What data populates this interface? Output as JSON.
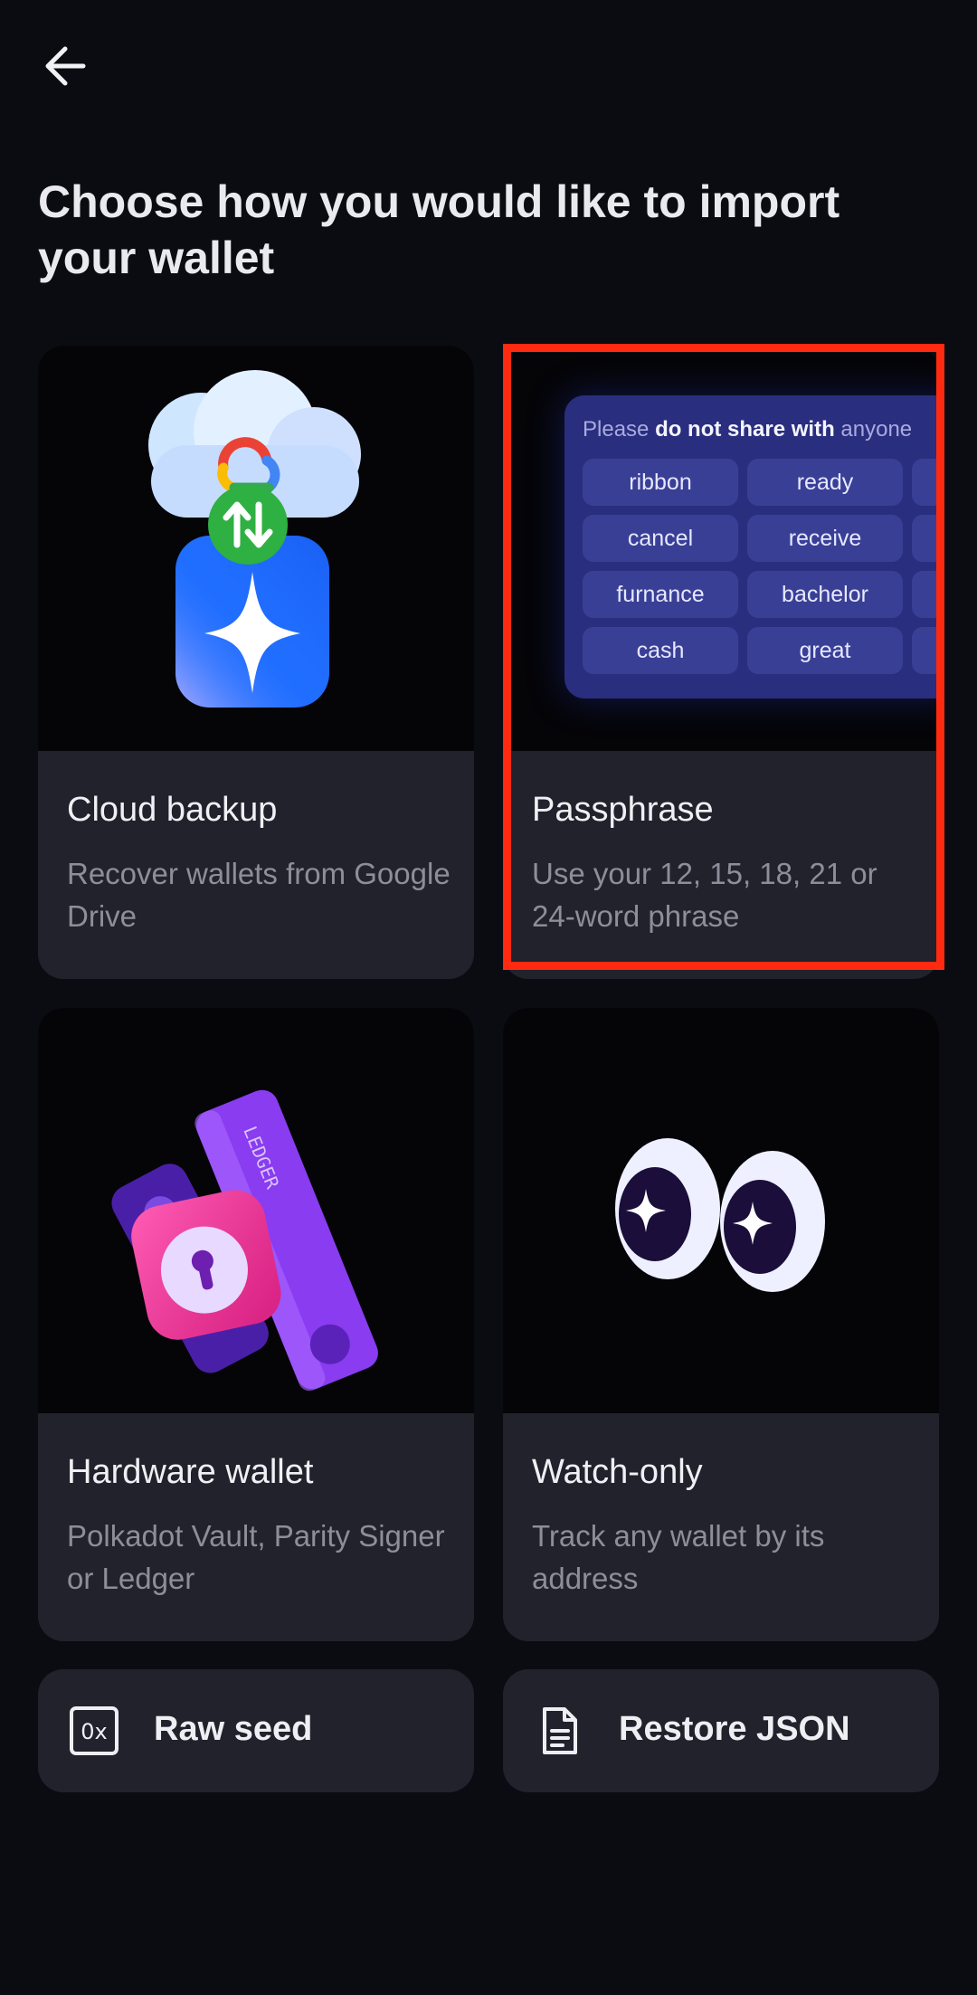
{
  "header": {
    "back_icon": "arrow-left-icon",
    "title": "Choose how you would like to import your wallet"
  },
  "options": [
    {
      "id": "cloud",
      "title": "Cloud backup",
      "description": "Recover wallets from Google Drive",
      "art_icon": "cloud-backup-illustration"
    },
    {
      "id": "passphrase",
      "title": "Passphrase",
      "description": "Use your 12, 15, 18, 21 or 24-word phrase",
      "art_icon": "passphrase-words-illustration",
      "highlighted": true
    },
    {
      "id": "hardware",
      "title": "Hardware wallet",
      "description": "Polkadot Vault, Parity Signer or Ledger",
      "art_icon": "hardware-wallet-illustration"
    },
    {
      "id": "watch",
      "title": "Watch-only",
      "description": "Track any wallet by its address",
      "art_icon": "eyes-illustration"
    }
  ],
  "passphrase_art": {
    "header_plain_1": "Please ",
    "header_bold": "do not share with",
    "header_plain_2": " anyone",
    "words": [
      "ribbon",
      "ready",
      "cancel",
      "receive",
      "furnance",
      "bachelor",
      "cash",
      "great"
    ]
  },
  "ledger_label": "LEDGER",
  "actions": [
    {
      "id": "raw_seed",
      "label": "Raw seed",
      "icon": "hex-0x-icon"
    },
    {
      "id": "restore_json",
      "label": "Restore JSON",
      "icon": "document-icon"
    }
  ],
  "colors": {
    "background": "#0b0c12",
    "card": "#22222d",
    "highlight": "#ff2a10",
    "muted_text": "#8d8e9a"
  }
}
